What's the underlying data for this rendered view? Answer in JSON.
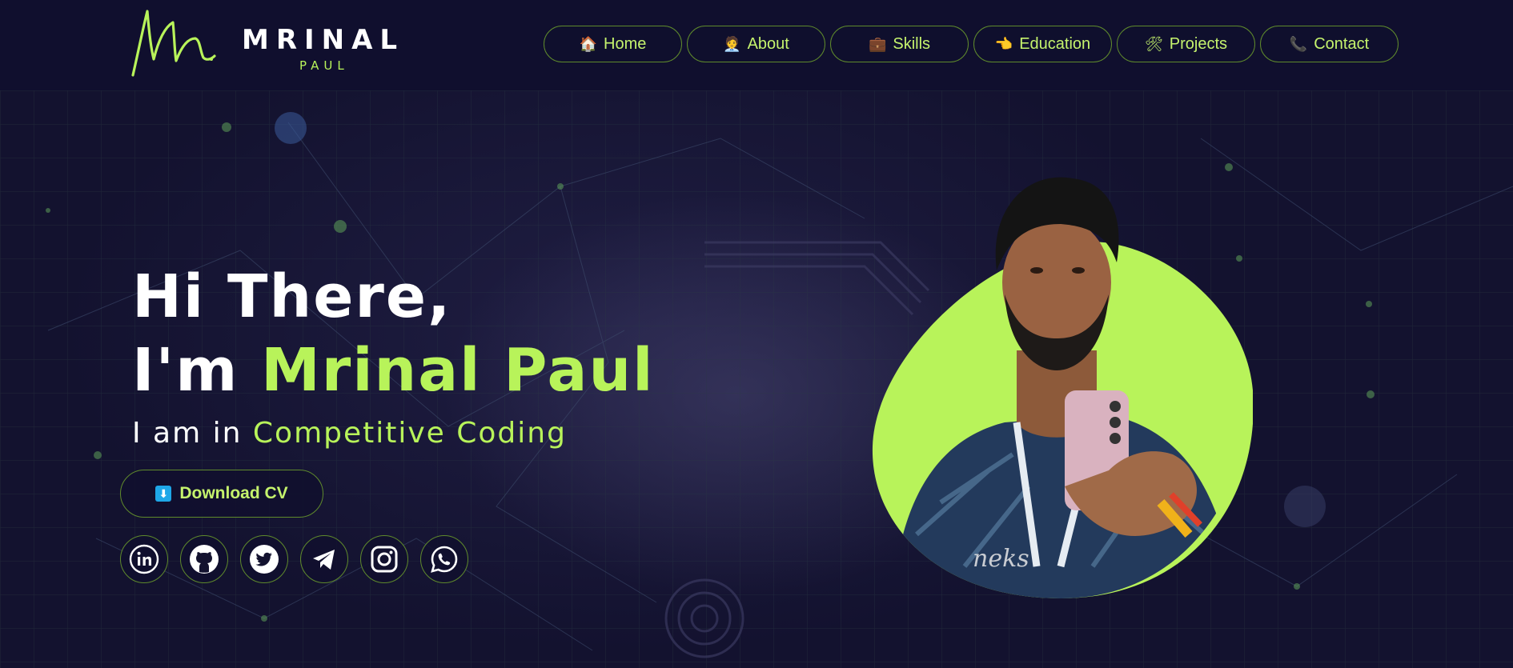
{
  "logo": {
    "name": "MRINAL",
    "sub": "PAUL"
  },
  "nav": [
    {
      "icon": "🏠",
      "label": "Home"
    },
    {
      "icon": "🧑‍💼",
      "label": "About"
    },
    {
      "icon": "💼",
      "label": "Skills"
    },
    {
      "icon": "👈",
      "label": "Education"
    },
    {
      "icon": "🛠",
      "label": "Projects"
    },
    {
      "icon": "📞",
      "label": "Contact"
    }
  ],
  "hero": {
    "greeting_line1": "Hi There,",
    "greeting_prefix": "I'm ",
    "name": "Mrinal Paul",
    "tagline_prefix": "I am in ",
    "tagline_highlight": "Competitive Coding",
    "cv_icon": "⬇",
    "cv_label": "Download CV"
  },
  "socials": [
    "linkedin-icon",
    "github-icon",
    "twitter-icon",
    "telegram-icon",
    "instagram-icon",
    "whatsapp-icon"
  ],
  "colors": {
    "background": "#100f2e",
    "accent": "#b8f35a",
    "border": "#5f8a2c"
  }
}
